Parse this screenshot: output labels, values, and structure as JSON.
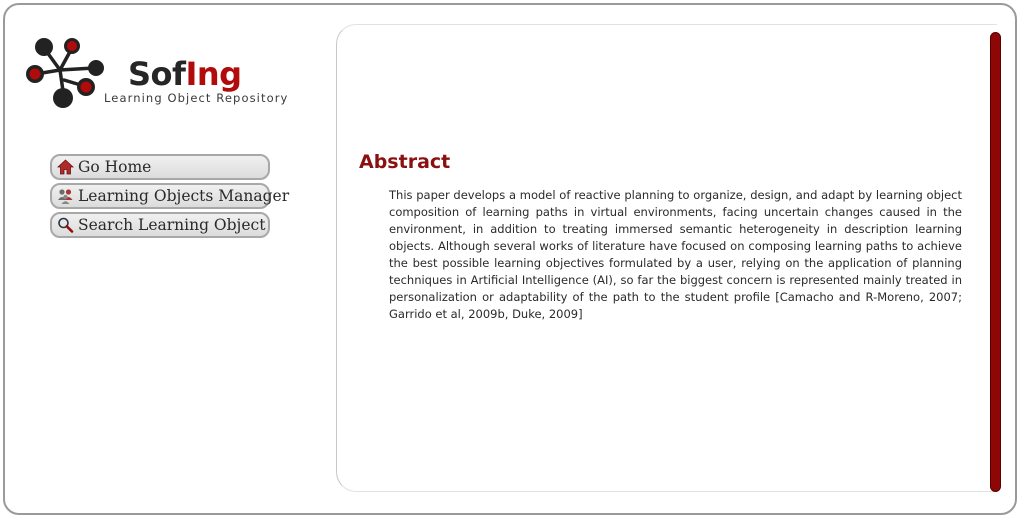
{
  "logo": {
    "brand_part1": "Sof",
    "brand_part2": "Ing",
    "tagline": "Learning Object Repository"
  },
  "nav": {
    "items": [
      {
        "label": "Go Home",
        "icon": "home-icon"
      },
      {
        "label": "Learning Objects Manager",
        "icon": "users-icon"
      },
      {
        "label": "Search Learning Object",
        "icon": "search-icon"
      }
    ]
  },
  "main": {
    "title": "Abstract",
    "body": "This paper develops a model of reactive planning to organize, design, and adapt by learning object composition of learning paths in virtual environments, facing uncertain changes caused in the environment, in addition to treating immersed semantic heterogeneity in description learning objects. Although several works of literature have focused on composing learning paths to achieve the best possible learning objectives formulated by a user, relying on the application of planning techniques in Artificial Intelligence (AI), so far the biggest concern is represented mainly treated in personalization or adaptability of the path to the student profile [Camacho and R-Moreno, 2007; Garrido et al, 2009b, Duke, 2009]"
  },
  "colors": {
    "accent": "#8b1010",
    "scrollbar": "#8e0606"
  }
}
